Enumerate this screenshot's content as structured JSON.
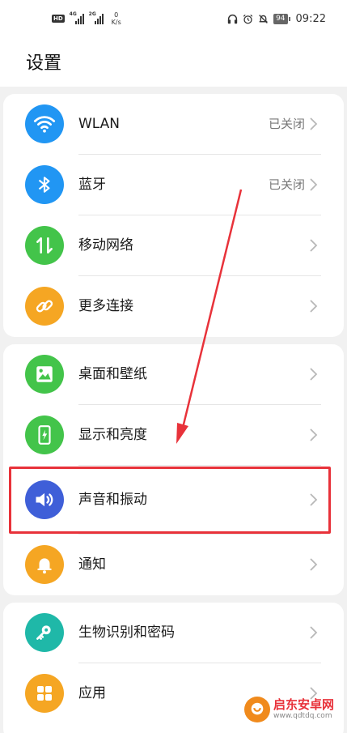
{
  "status_bar": {
    "hd": "HD",
    "net1": "4G",
    "net2": "2G",
    "speed_value": "0",
    "speed_unit": "K/s",
    "battery": "94",
    "time": "09:22",
    "icons": [
      "headphones-icon",
      "alarm-icon",
      "mute-icon",
      "battery-icon"
    ]
  },
  "header": {
    "title": "设置"
  },
  "groups": [
    {
      "items": [
        {
          "label": "WLAN",
          "value": "已关闭",
          "icon": "wifi-icon",
          "color": "#2196f3"
        },
        {
          "label": "蓝牙",
          "value": "已关闭",
          "icon": "bluetooth-icon",
          "color": "#2196f3"
        },
        {
          "label": "移动网络",
          "value": "",
          "icon": "mobile-data-icon",
          "color": "#43c44a"
        },
        {
          "label": "更多连接",
          "value": "",
          "icon": "link-icon",
          "color": "#f5a623"
        }
      ]
    },
    {
      "items": [
        {
          "label": "桌面和壁纸",
          "value": "",
          "icon": "wallpaper-icon",
          "color": "#43c44a"
        },
        {
          "label": "显示和亮度",
          "value": "",
          "icon": "display-icon",
          "color": "#43c44a"
        },
        {
          "label": "声音和振动",
          "value": "",
          "icon": "sound-icon",
          "color": "#3f5fd8"
        },
        {
          "label": "通知",
          "value": "",
          "icon": "bell-icon",
          "color": "#f5a623"
        }
      ]
    },
    {
      "items": [
        {
          "label": "生物识别和密码",
          "value": "",
          "icon": "key-icon",
          "color": "#1fb8a8"
        },
        {
          "label": "应用",
          "value": "",
          "icon": "apps-icon",
          "color": "#f5a623"
        }
      ]
    }
  ],
  "watermark": {
    "name": "启东安卓网",
    "url": "www.qdtdq.com"
  },
  "colors": {
    "highlight": "#e8323a",
    "chevron": "#b8b8b8"
  }
}
